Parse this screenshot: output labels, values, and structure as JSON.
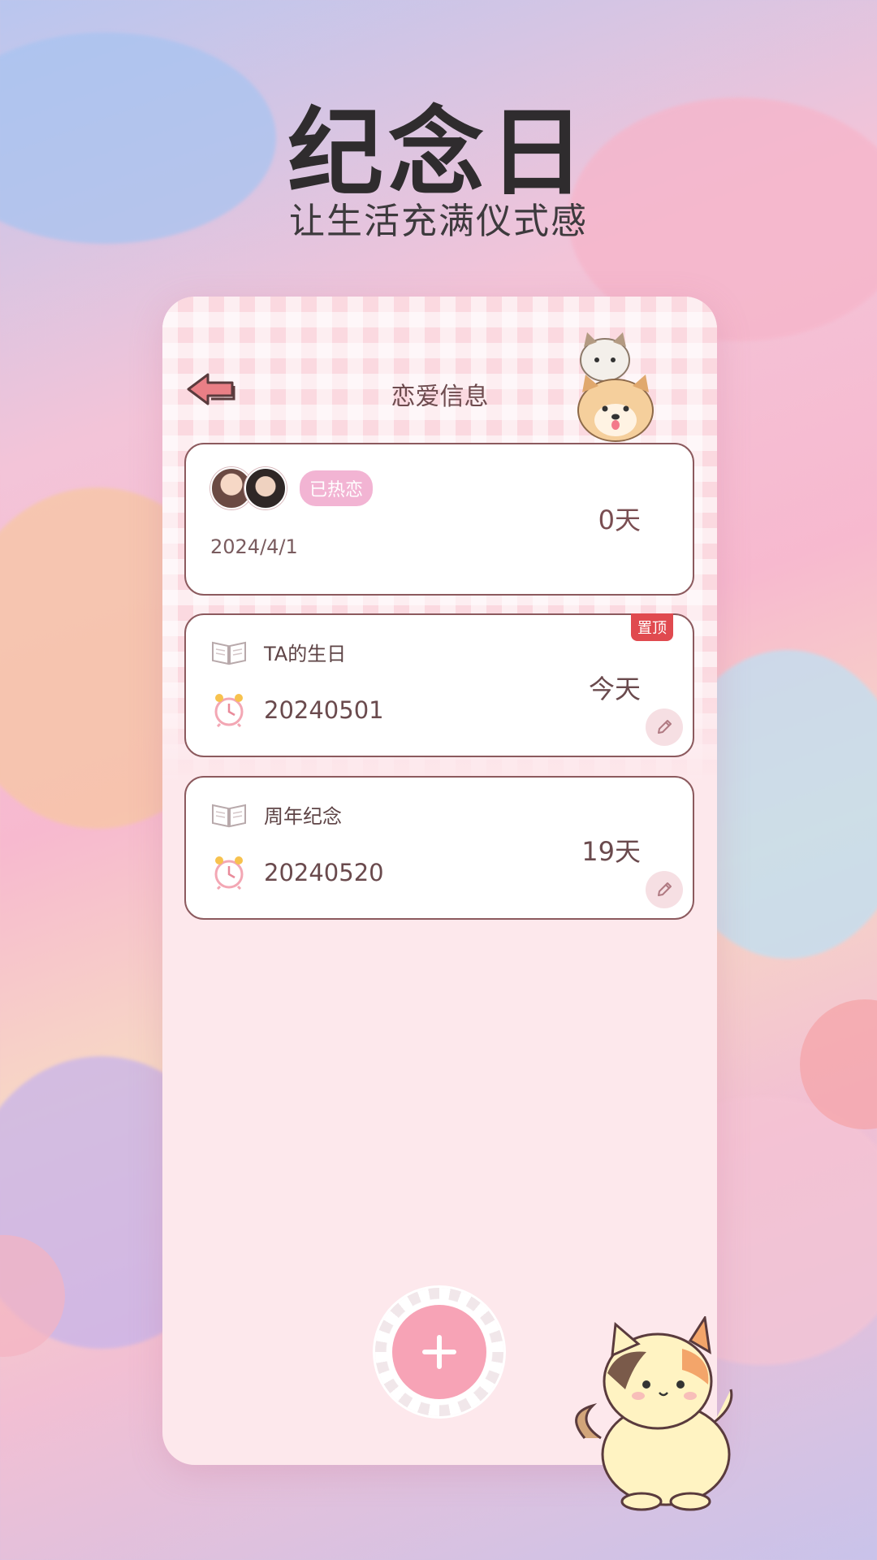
{
  "promo": {
    "headline": "纪念日",
    "subline": "让生活充满仪式感"
  },
  "nav": {
    "title": "恋爱信息",
    "back_icon": "back-arrow-icon"
  },
  "love_card": {
    "status_badge": "已热恋",
    "start_date": "2024/4/1",
    "days": "0天"
  },
  "events": [
    {
      "name": "TA的生日",
      "date": "20240501",
      "days": "今天",
      "pinned_label": "置顶"
    },
    {
      "name": "周年纪念",
      "date": "20240520",
      "days": "19天"
    }
  ],
  "colors": {
    "accent_pink": "#f7a3b6",
    "pin_red": "#e04a4f",
    "badge_pink": "#f2b4d3",
    "card_border": "#8c5a5e"
  }
}
